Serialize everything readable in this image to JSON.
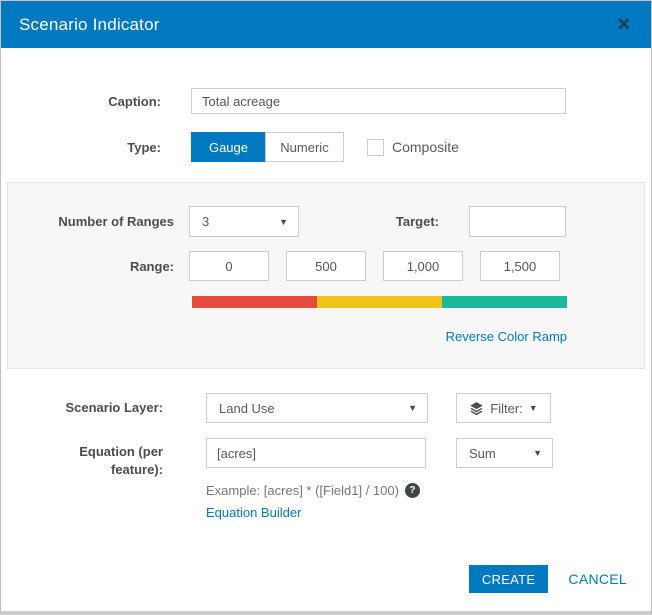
{
  "dialog": {
    "title": "Scenario Indicator"
  },
  "icons": {
    "close": "✕",
    "dropdown_arrow": "▼",
    "help": "?"
  },
  "colors": {
    "accent": "#0079c1"
  },
  "caption": {
    "label": "Caption:",
    "value": "Total acreage"
  },
  "type": {
    "label": "Type:",
    "options": [
      "Gauge",
      "Numeric"
    ],
    "selected": "Gauge",
    "composite_label": "Composite",
    "composite_checked": false
  },
  "ranges": {
    "number_of_ranges_label": "Number of Ranges",
    "number_of_ranges_value": "3",
    "target_label": "Target:",
    "target_value": "",
    "range_label": "Range:",
    "range_values": [
      "0",
      "500",
      "1,000",
      "1,500"
    ],
    "ramp_colors": [
      "#e64c3c",
      "#efc319",
      "#1aba9a"
    ],
    "reverse_link": "Reverse Color Ramp"
  },
  "layer": {
    "label": "Scenario Layer:",
    "value": "Land Use",
    "filter_label": "Filter:"
  },
  "equation": {
    "label_line1": "Equation (per",
    "label_line2": "feature):",
    "value": "[acres]",
    "aggregation": "Sum",
    "example": "Example: [acres] * ([Field1] / 100)",
    "builder_link": "Equation Builder"
  },
  "footer": {
    "create": "CREATE",
    "cancel": "CANCEL"
  }
}
